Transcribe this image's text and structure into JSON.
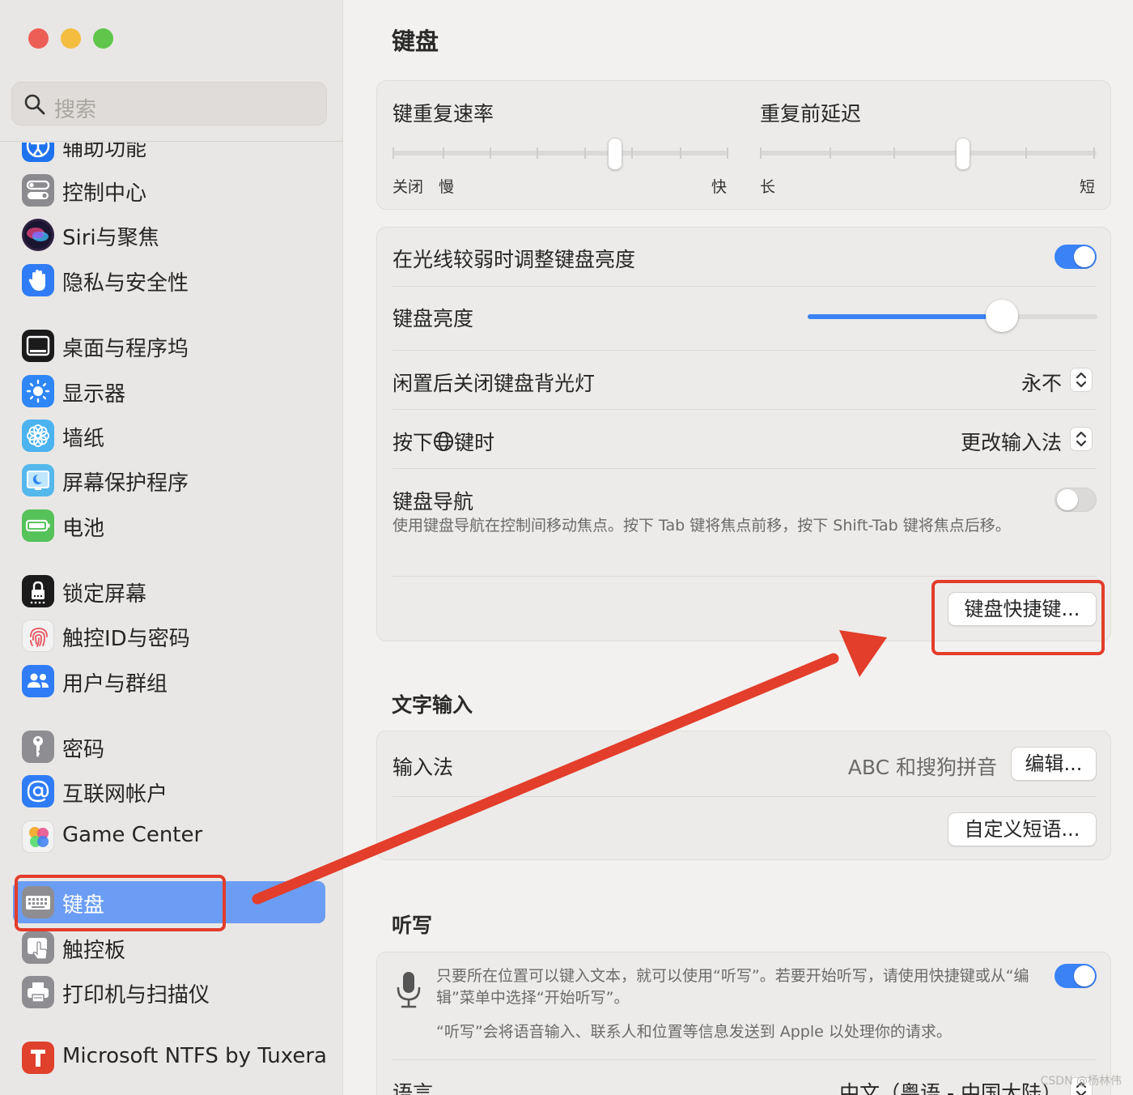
{
  "window": {
    "traffic_lights": [
      "#ed5e57",
      "#f5bd3f",
      "#5fc64b"
    ]
  },
  "sidebar": {
    "search_placeholder": "搜索",
    "items": [
      {
        "label": "辅助功能",
        "icon": "accessibility-icon",
        "color": "#1f72ee"
      },
      {
        "label": "控制中心",
        "icon": "control-center-icon",
        "color": "#8b8b8f"
      },
      {
        "label": "Siri与聚焦",
        "icon": "siri-icon",
        "color": "#2d2140"
      },
      {
        "label": "隐私与安全性",
        "icon": "privacy-hand-icon",
        "color": "#2f7cf6"
      },
      {
        "label": "桌面与程序坞",
        "icon": "dock-icon",
        "color": "#1b1b1b"
      },
      {
        "label": "显示器",
        "icon": "display-sun-icon",
        "color": "#2f86f6"
      },
      {
        "label": "墙纸",
        "icon": "wallpaper-flower-icon",
        "color": "#4ab3f0"
      },
      {
        "label": "屏幕保护程序",
        "icon": "screensaver-icon",
        "color": "#55b8ec"
      },
      {
        "label": "电池",
        "icon": "battery-icon",
        "color": "#55c25a"
      },
      {
        "label": "锁定屏幕",
        "icon": "lock-screen-icon",
        "color": "#1b1b1b"
      },
      {
        "label": "触控ID与密码",
        "icon": "fingerprint-icon",
        "color": "#f2f2f2"
      },
      {
        "label": "用户与群组",
        "icon": "users-icon",
        "color": "#2f7cf6"
      },
      {
        "label": "密码",
        "icon": "key-icon",
        "color": "#8e8e92"
      },
      {
        "label": "互联网帐户",
        "icon": "at-sign-icon",
        "color": "#2f7cf6"
      },
      {
        "label": "Game Center",
        "icon": "game-center-icon",
        "color": "#f2f2f2"
      },
      {
        "label": "键盘",
        "icon": "keyboard-icon",
        "color": "#8e8e92",
        "active": true
      },
      {
        "label": "触控板",
        "icon": "trackpad-icon",
        "color": "#8e8e92"
      },
      {
        "label": "打印机与扫描仪",
        "icon": "printer-icon",
        "color": "#8e8e92"
      },
      {
        "label": "Microsoft NTFS by Tuxera",
        "icon": "tuxera-icon",
        "color": "#e0412d"
      }
    ]
  },
  "main": {
    "title": "键盘",
    "repeat": {
      "rate_label": "键重复速率",
      "rate_off": "关闭",
      "rate_slow": "慢",
      "rate_fast": "快",
      "rate_value": 0.66,
      "delay_label": "重复前延迟",
      "delay_long": "长",
      "delay_short": "短",
      "delay_value": 0.6
    },
    "brightness": {
      "auto_label": "在光线较弱时调整键盘亮度",
      "auto_on": true,
      "level_label": "键盘亮度",
      "level_value": 0.67,
      "idle_label": "闲置后关闭键盘背光灯",
      "idle_value": "永不",
      "globe_label_pre": "按下",
      "globe_label_post": "键时",
      "globe_value": "更改输入法",
      "nav_label": "键盘导航",
      "nav_on": false,
      "nav_desc": "使用键盘导航在控制间移动焦点。按下 Tab 键将焦点前移，按下 Shift-Tab 键将焦点后移。",
      "shortcuts_button": "键盘快捷键..."
    },
    "text_input": {
      "section_title": "文字输入",
      "input_label": "输入法",
      "input_value": "ABC 和搜狗拼音",
      "edit_button": "编辑...",
      "phrases_button": "自定义短语..."
    },
    "dictation": {
      "section_title": "听写",
      "desc1": "只要所在位置可以键入文本，就可以使用“听写”。若要开始听写，请使用快捷键或从“编辑”菜单中选择“开始听写”。",
      "desc2": "“听写”会将语音输入、联系人和位置等信息发送到 Apple 以处理你的请求。",
      "on": true,
      "language_label": "语言",
      "language_value": "中文（粤语 - 中国大陆）"
    }
  },
  "annotation": {
    "color": "#e33d2b"
  },
  "watermark": "CSDN @杨林伟"
}
